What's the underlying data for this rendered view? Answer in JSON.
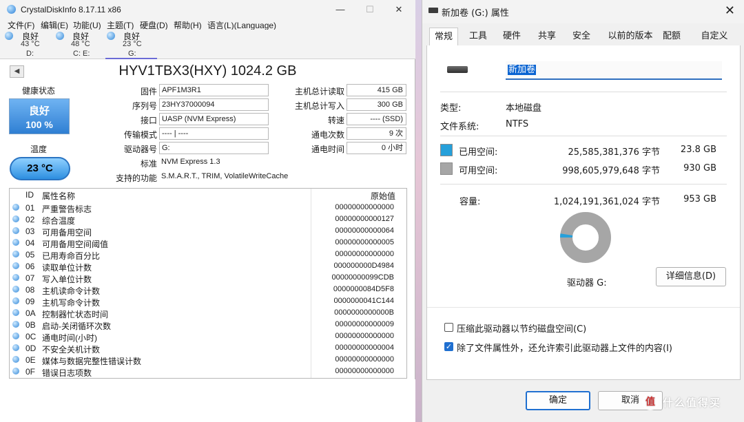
{
  "cdi": {
    "title": "CrystalDiskInfo 8.17.11 x86",
    "window_buttons": {
      "minimize": "—",
      "maximize": "☐",
      "close": "✕"
    },
    "menu": [
      "文件(F)",
      "编辑(E)",
      "功能(U)",
      "主题(T)",
      "硬盘(D)",
      "帮助(H)",
      "语言(L)(Language)"
    ],
    "drives": [
      {
        "status": "良好",
        "temp": "43 °C",
        "letter": "D:"
      },
      {
        "status": "良好",
        "temp": "48 °C",
        "letter": "C: E:"
      },
      {
        "status": "良好",
        "temp": "23 °C",
        "letter": "G:"
      }
    ],
    "nav_button": "◀",
    "drive_title": "HYV1TBX3(HXY) 1024.2 GB",
    "health": {
      "label": "健康状态",
      "status": "良好",
      "percent": "100 %"
    },
    "temperature": {
      "label": "温度",
      "value": "23 °C"
    },
    "fields_left": [
      {
        "label": "固件",
        "value": "APF1M3R1"
      },
      {
        "label": "序列号",
        "value": "23HY37000094"
      },
      {
        "label": "接口",
        "value": "UASP (NVM Express)"
      },
      {
        "label": "传输模式",
        "value": "---- | ----"
      },
      {
        "label": "驱动器号",
        "value": "G:"
      },
      {
        "label": "标准",
        "value": "NVM Express 1.3"
      },
      {
        "label": "支持的功能",
        "value": "S.M.A.R.T., TRIM, VolatileWriteCache"
      }
    ],
    "fields_right": [
      {
        "label": "主机总计读取",
        "value": "415 GB"
      },
      {
        "label": "主机总计写入",
        "value": "300 GB"
      },
      {
        "label": "转速",
        "value": "---- (SSD)"
      },
      {
        "label": "通电次数",
        "value": "9 次"
      },
      {
        "label": "通电时间",
        "value": "0 小时"
      }
    ],
    "smart": {
      "headers": {
        "id": "ID",
        "name": "属性名称",
        "raw": "原始值"
      },
      "rows": [
        {
          "id": "01",
          "name": "严重警告标志",
          "raw": "00000000000000"
        },
        {
          "id": "02",
          "name": "综合温度",
          "raw": "00000000000127"
        },
        {
          "id": "03",
          "name": "可用备用空间",
          "raw": "00000000000064"
        },
        {
          "id": "04",
          "name": "可用备用空间阈值",
          "raw": "00000000000005"
        },
        {
          "id": "05",
          "name": "已用寿命百分比",
          "raw": "00000000000000"
        },
        {
          "id": "06",
          "name": "读取单位计数",
          "raw": "000000000D4984"
        },
        {
          "id": "07",
          "name": "写入单位计数",
          "raw": "00000000099CDB"
        },
        {
          "id": "08",
          "name": "主机读命令计数",
          "raw": "0000000084D5F8"
        },
        {
          "id": "09",
          "name": "主机写命令计数",
          "raw": "0000000041C144"
        },
        {
          "id": "0A",
          "name": "控制器忙状态时间",
          "raw": "0000000000000B"
        },
        {
          "id": "0B",
          "name": "启动-关闭循环次数",
          "raw": "00000000000009"
        },
        {
          "id": "0C",
          "name": "通电时间(小时)",
          "raw": "00000000000000"
        },
        {
          "id": "0D",
          "name": "不安全关机计数",
          "raw": "00000000000004"
        },
        {
          "id": "0E",
          "name": "媒体与数据完整性错误计数",
          "raw": "00000000000000"
        },
        {
          "id": "0F",
          "name": "错误日志项数",
          "raw": "00000000000000"
        }
      ]
    }
  },
  "props": {
    "title": "新加卷 (G:) 属性",
    "close": "✕",
    "tabs": [
      "常规",
      "工具",
      "硬件",
      "共享",
      "安全",
      "以前的版本",
      "配额",
      "自定义"
    ],
    "volume_name": "新加卷",
    "type_label": "类型:",
    "type_value": "本地磁盘",
    "fs_label": "文件系统:",
    "fs_value": "NTFS",
    "used": {
      "label": "已用空间:",
      "bytes": "25,585,381,376 字节",
      "size": "23.8 GB",
      "color": "#26a0da"
    },
    "free": {
      "label": "可用空间:",
      "bytes": "998,605,979,648 字节",
      "size": "930 GB",
      "color": "#a6a6a6"
    },
    "capacity": {
      "label": "容量:",
      "bytes": "1,024,191,361,024 字节",
      "size": "953 GB"
    },
    "used_fraction": 0.025,
    "drive_label": "驱动器 G:",
    "details_button": "详细信息(D)",
    "compress_label": "压缩此驱动器以节约磁盘空间(C)",
    "compress_checked": false,
    "index_label": "除了文件属性外，还允许索引此驱动器上文件的内容(I)",
    "index_checked": true,
    "ok_button": "确定",
    "cancel_button": "取消"
  },
  "watermark": {
    "logo": "值",
    "text": "什么值得买"
  }
}
